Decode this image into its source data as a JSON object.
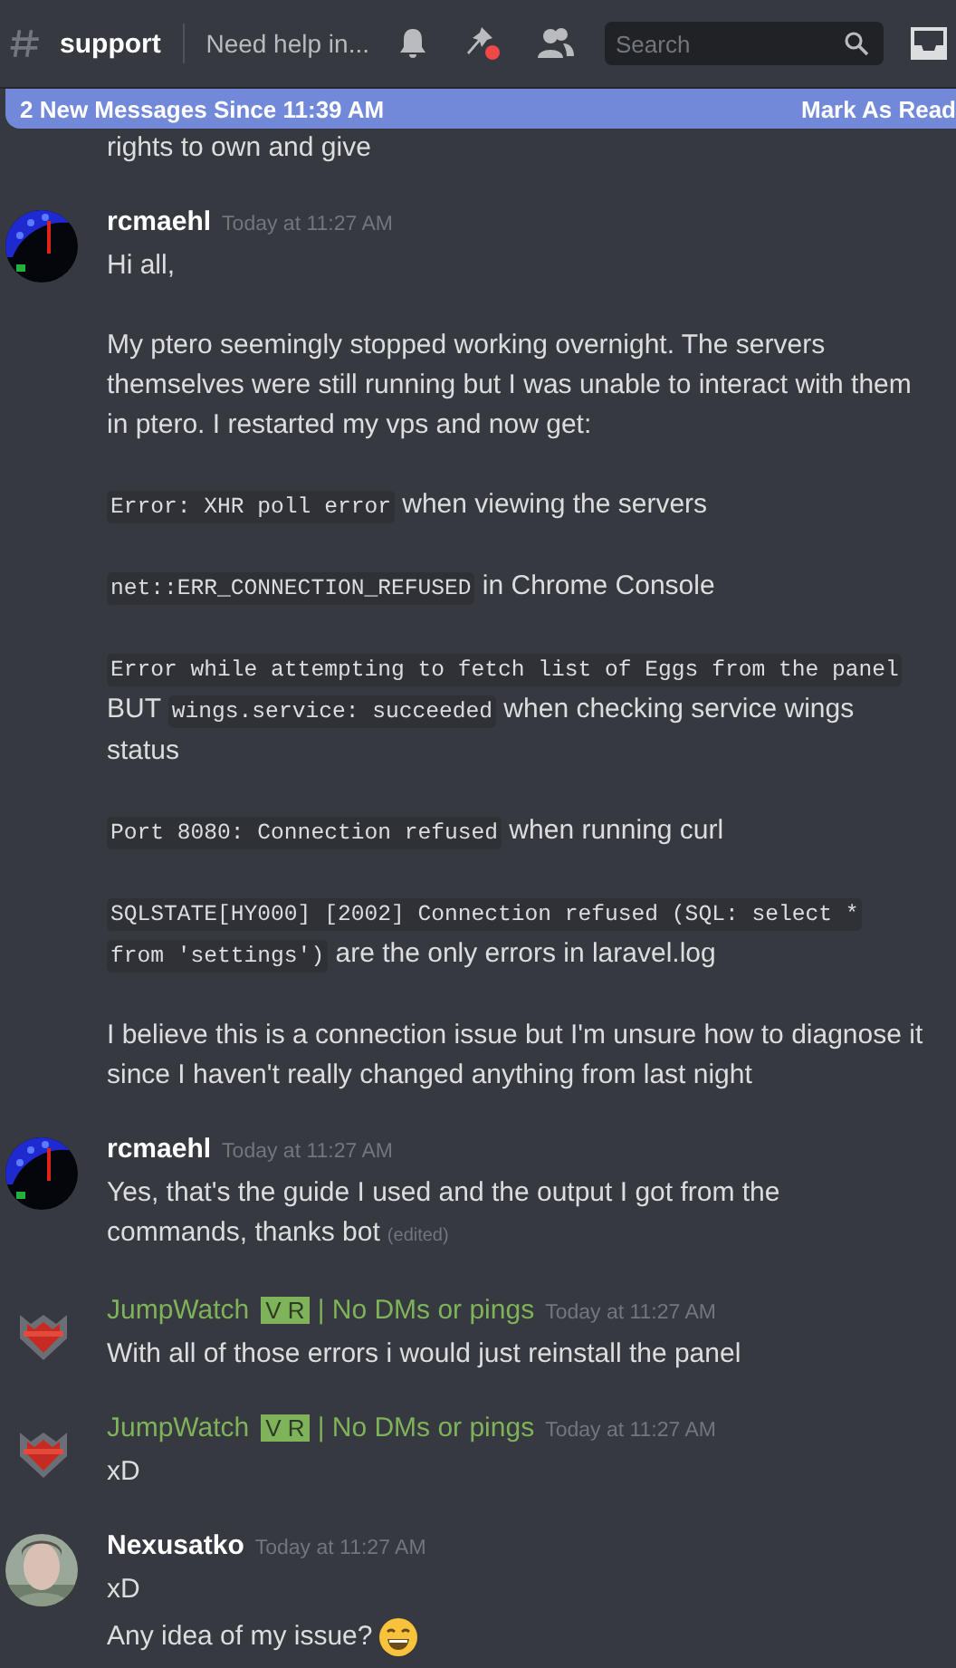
{
  "channel": {
    "name": "support",
    "topic": "Need help in..."
  },
  "search": {
    "placeholder": "Search"
  },
  "banner": {
    "text": "2 New Messages Since 11:39 AM",
    "action": "Mark As Read"
  },
  "groups": [
    {
      "kind": "continuation",
      "messages": [
        {
          "paragraphs": [
            [
              {
                "kind": "text",
                "text": "rights to own and give"
              }
            ]
          ]
        }
      ]
    },
    {
      "kind": "full",
      "author": "rcmaehl",
      "color": "#ffffff",
      "avatar": {
        "kind": "gauge"
      },
      "time": "Today at 11:27 AM",
      "messages": [
        {
          "paragraphs": [
            [
              {
                "kind": "text",
                "text": "Hi all,"
              }
            ],
            [
              {
                "kind": "text",
                "text": "My ptero seemingly stopped working overnight. The servers themselves were still running but I was unable to interact with them in ptero. I restarted my vps and now get:"
              }
            ],
            [
              {
                "kind": "code",
                "text": "Error: XHR poll error"
              },
              {
                "kind": "text",
                "text": " when viewing the servers"
              }
            ],
            [
              {
                "kind": "code",
                "text": "net::ERR_CONNECTION_REFUSED"
              },
              {
                "kind": "text",
                "text": " in Chrome Console"
              }
            ],
            [
              {
                "kind": "code",
                "text": "Error while attempting to fetch list of Eggs from the panel"
              },
              {
                "kind": "text",
                "text": " BUT "
              },
              {
                "kind": "code",
                "text": "wings.service: succeeded"
              },
              {
                "kind": "text",
                "text": " when checking service wings"
              },
              {
                "kind": "break"
              },
              {
                "kind": "text",
                "text": "status"
              }
            ],
            [
              {
                "kind": "code",
                "text": "Port 8080: Connection refused"
              },
              {
                "kind": "text",
                "text": " when running curl"
              }
            ],
            [
              {
                "kind": "code",
                "text": "SQLSTATE[HY000] [2002] Connection refused (SQL: select *"
              },
              {
                "kind": "break"
              },
              {
                "kind": "code",
                "text": "from 'settings')"
              },
              {
                "kind": "text",
                "text": " are the only errors in laravel.log"
              }
            ],
            [
              {
                "kind": "text",
                "text": "I believe this is a connection issue but I'm unsure how to diagnose it since I haven't really changed anything from last night"
              }
            ]
          ]
        }
      ]
    },
    {
      "kind": "full",
      "author": "rcmaehl",
      "color": "#ffffff",
      "avatar": {
        "kind": "gauge"
      },
      "time": "Today at 11:27 AM",
      "messages": [
        {
          "paragraphs": [
            [
              {
                "kind": "text",
                "text": "Yes, that's the guide I used and the output I got from the"
              },
              {
                "kind": "break"
              },
              {
                "kind": "text",
                "text": "commands, thanks bot"
              },
              {
                "kind": "edited",
                "text": "(edited)"
              }
            ]
          ]
        }
      ]
    },
    {
      "kind": "full",
      "author": "JumpWatch",
      "color": "#7fb35a",
      "tag": "V R",
      "suffix": "| No DMs or pings",
      "avatar": {
        "kind": "shield"
      },
      "time": "Today at 11:27 AM",
      "messages": [
        {
          "paragraphs": [
            [
              {
                "kind": "text",
                "text": "With all of those errors i would just reinstall the panel"
              }
            ]
          ]
        }
      ]
    },
    {
      "kind": "full",
      "author": "JumpWatch",
      "color": "#7fb35a",
      "tag": "V R",
      "suffix": "| No DMs or pings",
      "avatar": {
        "kind": "shield"
      },
      "time": "Today at 11:27 AM",
      "messages": [
        {
          "paragraphs": [
            [
              {
                "kind": "text",
                "text": "xD"
              }
            ]
          ]
        }
      ]
    },
    {
      "kind": "full",
      "author": "Nexusatko",
      "color": "#ffffff",
      "avatar": {
        "kind": "person"
      },
      "time": "Today at 11:27 AM",
      "messages": [
        {
          "paragraphs": [
            [
              {
                "kind": "text",
                "text": "xD"
              }
            ]
          ]
        },
        {
          "paragraphs": [
            [
              {
                "kind": "text",
                "text": "Any idea of my issue?"
              },
              {
                "kind": "emoji"
              }
            ]
          ]
        }
      ]
    }
  ]
}
